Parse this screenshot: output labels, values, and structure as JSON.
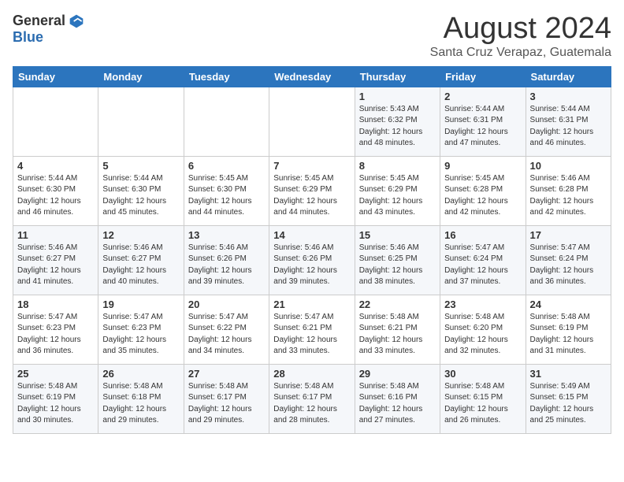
{
  "header": {
    "logo_general": "General",
    "logo_blue": "Blue",
    "month_title": "August 2024",
    "location": "Santa Cruz Verapaz, Guatemala"
  },
  "days_of_week": [
    "Sunday",
    "Monday",
    "Tuesday",
    "Wednesday",
    "Thursday",
    "Friday",
    "Saturday"
  ],
  "weeks": [
    [
      {
        "day": "",
        "info": ""
      },
      {
        "day": "",
        "info": ""
      },
      {
        "day": "",
        "info": ""
      },
      {
        "day": "",
        "info": ""
      },
      {
        "day": "1",
        "info": "Sunrise: 5:43 AM\nSunset: 6:32 PM\nDaylight: 12 hours\nand 48 minutes."
      },
      {
        "day": "2",
        "info": "Sunrise: 5:44 AM\nSunset: 6:31 PM\nDaylight: 12 hours\nand 47 minutes."
      },
      {
        "day": "3",
        "info": "Sunrise: 5:44 AM\nSunset: 6:31 PM\nDaylight: 12 hours\nand 46 minutes."
      }
    ],
    [
      {
        "day": "4",
        "info": "Sunrise: 5:44 AM\nSunset: 6:30 PM\nDaylight: 12 hours\nand 46 minutes."
      },
      {
        "day": "5",
        "info": "Sunrise: 5:44 AM\nSunset: 6:30 PM\nDaylight: 12 hours\nand 45 minutes."
      },
      {
        "day": "6",
        "info": "Sunrise: 5:45 AM\nSunset: 6:30 PM\nDaylight: 12 hours\nand 44 minutes."
      },
      {
        "day": "7",
        "info": "Sunrise: 5:45 AM\nSunset: 6:29 PM\nDaylight: 12 hours\nand 44 minutes."
      },
      {
        "day": "8",
        "info": "Sunrise: 5:45 AM\nSunset: 6:29 PM\nDaylight: 12 hours\nand 43 minutes."
      },
      {
        "day": "9",
        "info": "Sunrise: 5:45 AM\nSunset: 6:28 PM\nDaylight: 12 hours\nand 42 minutes."
      },
      {
        "day": "10",
        "info": "Sunrise: 5:46 AM\nSunset: 6:28 PM\nDaylight: 12 hours\nand 42 minutes."
      }
    ],
    [
      {
        "day": "11",
        "info": "Sunrise: 5:46 AM\nSunset: 6:27 PM\nDaylight: 12 hours\nand 41 minutes."
      },
      {
        "day": "12",
        "info": "Sunrise: 5:46 AM\nSunset: 6:27 PM\nDaylight: 12 hours\nand 40 minutes."
      },
      {
        "day": "13",
        "info": "Sunrise: 5:46 AM\nSunset: 6:26 PM\nDaylight: 12 hours\nand 39 minutes."
      },
      {
        "day": "14",
        "info": "Sunrise: 5:46 AM\nSunset: 6:26 PM\nDaylight: 12 hours\nand 39 minutes."
      },
      {
        "day": "15",
        "info": "Sunrise: 5:46 AM\nSunset: 6:25 PM\nDaylight: 12 hours\nand 38 minutes."
      },
      {
        "day": "16",
        "info": "Sunrise: 5:47 AM\nSunset: 6:24 PM\nDaylight: 12 hours\nand 37 minutes."
      },
      {
        "day": "17",
        "info": "Sunrise: 5:47 AM\nSunset: 6:24 PM\nDaylight: 12 hours\nand 36 minutes."
      }
    ],
    [
      {
        "day": "18",
        "info": "Sunrise: 5:47 AM\nSunset: 6:23 PM\nDaylight: 12 hours\nand 36 minutes."
      },
      {
        "day": "19",
        "info": "Sunrise: 5:47 AM\nSunset: 6:23 PM\nDaylight: 12 hours\nand 35 minutes."
      },
      {
        "day": "20",
        "info": "Sunrise: 5:47 AM\nSunset: 6:22 PM\nDaylight: 12 hours\nand 34 minutes."
      },
      {
        "day": "21",
        "info": "Sunrise: 5:47 AM\nSunset: 6:21 PM\nDaylight: 12 hours\nand 33 minutes."
      },
      {
        "day": "22",
        "info": "Sunrise: 5:48 AM\nSunset: 6:21 PM\nDaylight: 12 hours\nand 33 minutes."
      },
      {
        "day": "23",
        "info": "Sunrise: 5:48 AM\nSunset: 6:20 PM\nDaylight: 12 hours\nand 32 minutes."
      },
      {
        "day": "24",
        "info": "Sunrise: 5:48 AM\nSunset: 6:19 PM\nDaylight: 12 hours\nand 31 minutes."
      }
    ],
    [
      {
        "day": "25",
        "info": "Sunrise: 5:48 AM\nSunset: 6:19 PM\nDaylight: 12 hours\nand 30 minutes."
      },
      {
        "day": "26",
        "info": "Sunrise: 5:48 AM\nSunset: 6:18 PM\nDaylight: 12 hours\nand 29 minutes."
      },
      {
        "day": "27",
        "info": "Sunrise: 5:48 AM\nSunset: 6:17 PM\nDaylight: 12 hours\nand 29 minutes."
      },
      {
        "day": "28",
        "info": "Sunrise: 5:48 AM\nSunset: 6:17 PM\nDaylight: 12 hours\nand 28 minutes."
      },
      {
        "day": "29",
        "info": "Sunrise: 5:48 AM\nSunset: 6:16 PM\nDaylight: 12 hours\nand 27 minutes."
      },
      {
        "day": "30",
        "info": "Sunrise: 5:48 AM\nSunset: 6:15 PM\nDaylight: 12 hours\nand 26 minutes."
      },
      {
        "day": "31",
        "info": "Sunrise: 5:49 AM\nSunset: 6:15 PM\nDaylight: 12 hours\nand 25 minutes."
      }
    ]
  ]
}
